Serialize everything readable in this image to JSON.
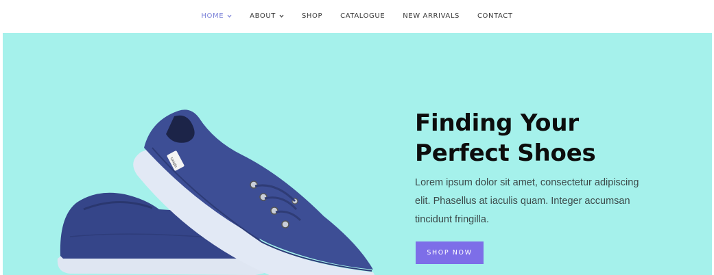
{
  "nav": {
    "items": [
      {
        "label": "HOME",
        "has_dropdown": true,
        "active": true
      },
      {
        "label": "ABOUT",
        "has_dropdown": true,
        "active": false
      },
      {
        "label": "SHOP",
        "has_dropdown": false,
        "active": false
      },
      {
        "label": "CATALOGUE",
        "has_dropdown": false,
        "active": false
      },
      {
        "label": "NEW ARRIVALS",
        "has_dropdown": false,
        "active": false
      },
      {
        "label": "CONTACT",
        "has_dropdown": false,
        "active": false
      }
    ]
  },
  "hero": {
    "title_line1": "Finding Your",
    "title_line2": "Perfect Shoes",
    "description": "Lorem ipsum dolor sit amet, consectetur adipiscing elit. Phasellus at iaculis quam. Integer accumsan tincidunt fringilla.",
    "cta_label": "SHOP NOW",
    "shoe_tag_text": "Uniqlo"
  },
  "colors": {
    "hero_background": "#a5f1eb",
    "active_nav": "#7b82d8",
    "cta_background": "#7d6ee8",
    "shoe_blue": "#3a4a8e"
  }
}
